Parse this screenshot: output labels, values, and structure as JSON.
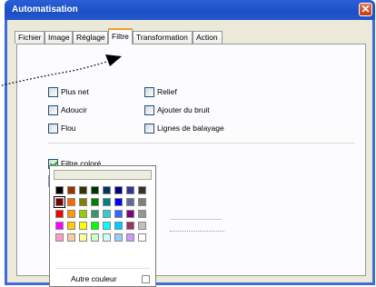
{
  "window": {
    "title": "Automatisation",
    "close_label": "✕"
  },
  "tabs": [
    {
      "label": "Fichier"
    },
    {
      "label": "Image"
    },
    {
      "label": "Réglage"
    },
    {
      "label": "Filtre"
    },
    {
      "label": "Transformation"
    },
    {
      "label": "Action"
    }
  ],
  "active_tab": "Filtre",
  "filters": {
    "left": [
      {
        "label": "Plus net",
        "checked": false
      },
      {
        "label": "Adoucir",
        "checked": false
      },
      {
        "label": "Flou",
        "checked": false
      }
    ],
    "right": [
      {
        "label": "Relief",
        "checked": false
      },
      {
        "label": "Ajouter du bruit",
        "checked": false
      },
      {
        "label": "Lignes de balayage",
        "checked": false
      }
    ]
  },
  "color_filter": {
    "label": "Filtre coloré",
    "checked": true,
    "selected_color": "#8b0000"
  },
  "palette": {
    "other_color_label": "Autre couleur",
    "rows": [
      [
        "#000000",
        "#993300",
        "#333300",
        "#003300",
        "#003366",
        "#000080",
        "#333399",
        "#333333"
      ],
      [
        "#800000",
        "#ff6600",
        "#808000",
        "#008000",
        "#008080",
        "#0000ff",
        "#666699",
        "#808080"
      ],
      [
        "#ff0000",
        "#ff9900",
        "#99cc00",
        "#339966",
        "#33cccc",
        "#3366ff",
        "#800080",
        "#969696"
      ],
      [
        "#ff00ff",
        "#ffcc00",
        "#ffff00",
        "#00ff00",
        "#00ffff",
        "#00ccff",
        "#993366",
        "#c0c0c0"
      ],
      [
        "#ff99cc",
        "#ffcc99",
        "#ffff99",
        "#ccffcc",
        "#ccffff",
        "#99ccff",
        "#cc99ff",
        "#ffffff"
      ]
    ],
    "selected": [
      1,
      0
    ]
  }
}
